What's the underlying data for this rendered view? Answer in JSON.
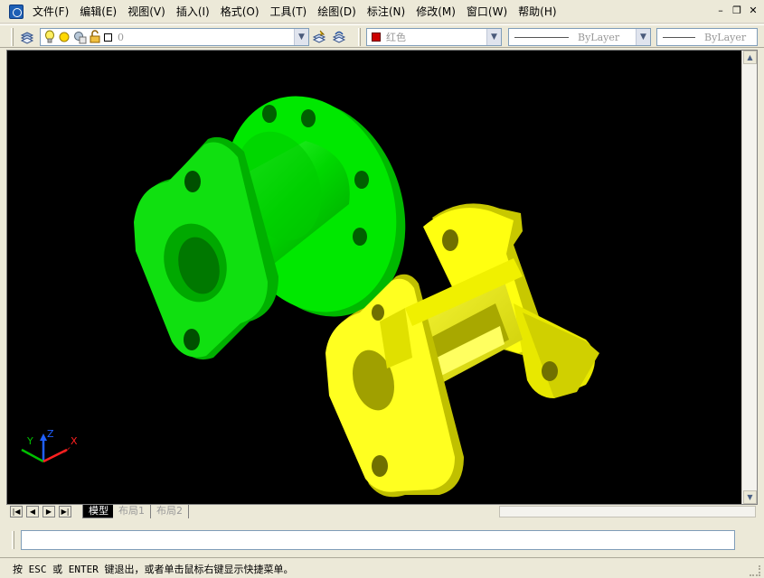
{
  "menu": {
    "items": [
      {
        "label": "文件(F)"
      },
      {
        "label": "编辑(E)"
      },
      {
        "label": "视图(V)"
      },
      {
        "label": "插入(I)"
      },
      {
        "label": "格式(O)"
      },
      {
        "label": "工具(T)"
      },
      {
        "label": "绘图(D)"
      },
      {
        "label": "标注(N)"
      },
      {
        "label": "修改(M)"
      },
      {
        "label": "窗口(W)"
      },
      {
        "label": "帮助(H)"
      }
    ]
  },
  "window_controls": {
    "minimize": "–",
    "restore": "❐",
    "close": "✕"
  },
  "toolbar": {
    "layer_value": "0",
    "color_value": "红色",
    "color_swatch": "#cc0000",
    "linetype_value": "ByLayer",
    "lineweight_value": "ByLayer"
  },
  "viewport": {
    "background": "#000000",
    "part_green_color": "#00dd00",
    "part_yellow_color": "#ffff00",
    "ucs": {
      "x": "X",
      "y": "Y",
      "z": "Z"
    }
  },
  "layout_tabs": {
    "model": "模型",
    "layout1": "布局1",
    "layout2": "布局2"
  },
  "command_line": {
    "value": ""
  },
  "status": {
    "text": "按 ESC 或 ENTER 键退出，或者单击鼠标右键显示快捷菜单。"
  }
}
